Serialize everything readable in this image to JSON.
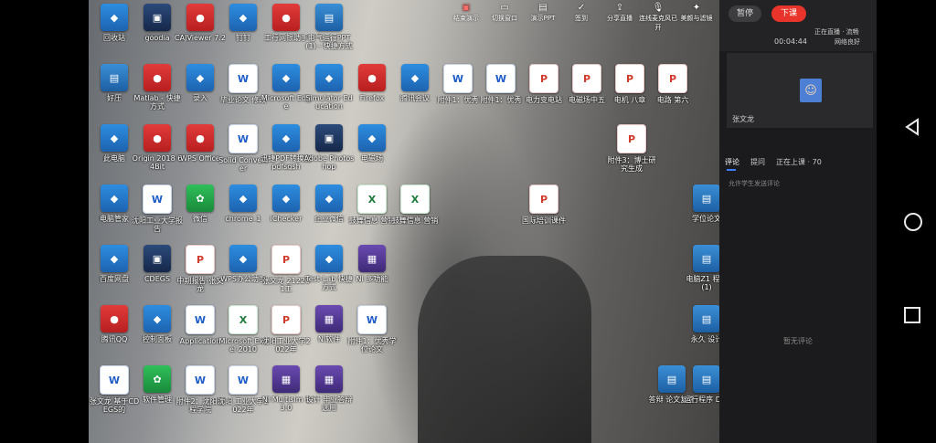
{
  "toolbar": {
    "items": [
      {
        "label": "结束演示",
        "icon": "screen-share-stop-icon",
        "color": "#ff6b6b"
      },
      {
        "label": "切换窗口",
        "icon": "window-switch-icon"
      },
      {
        "label": "演示PPT",
        "icon": "ppt-icon"
      },
      {
        "label": "签到",
        "icon": "check-in-icon"
      },
      {
        "label": "分享直播",
        "icon": "share-icon"
      },
      {
        "label": "连线麦克风已开",
        "icon": "mic-icon"
      },
      {
        "label": "美颜与滤镜",
        "icon": "beauty-icon"
      }
    ]
  },
  "desktop": {
    "rows": [
      [
        {
          "label": "回收站",
          "type": "app"
        },
        {
          "label": "goodia",
          "type": "dark"
        },
        {
          "label": "CAJViewer 7.2",
          "type": "red"
        },
        {
          "label": "钉钉",
          "type": "app"
        },
        {
          "label": "工行网银助手",
          "type": "red"
        },
        {
          "label": "电气运行PPT(1) - 快捷方式",
          "type": "rar"
        }
      ],
      [
        {
          "label": "好压",
          "type": "rar"
        },
        {
          "label": "Matlab - 快捷方式",
          "type": "red"
        },
        {
          "label": "录入",
          "type": "app"
        },
        {
          "label": "毕业论文 修改",
          "type": "doc"
        },
        {
          "label": "Microsoft Edge",
          "type": "app"
        },
        {
          "label": "Simulator Education",
          "type": "app"
        },
        {
          "label": "Firefox",
          "type": "red"
        },
        {
          "label": "腾讯会议",
          "type": "app"
        },
        {
          "label": "附件1：优秀",
          "type": "doc"
        },
        {
          "label": "附件1：优秀",
          "type": "doc"
        },
        {
          "label": "电力变电站",
          "type": "pdf"
        },
        {
          "label": "电磁场中五",
          "type": "pdf"
        },
        {
          "label": "电机 八章",
          "type": "pdf"
        },
        {
          "label": "电路 第六",
          "type": "pdf"
        }
      ],
      [
        {
          "label": "此电脑",
          "type": "app"
        },
        {
          "label": "Origin 2018 64Bit",
          "type": "red"
        },
        {
          "label": "WPS Office",
          "type": "red"
        },
        {
          "label": "Solid Converter",
          "type": "doc"
        },
        {
          "label": "迅捷PDF转换器pdfsgsh",
          "type": "app"
        },
        {
          "label": "Adobe Photoshop",
          "type": "dark"
        },
        {
          "label": "电磁场",
          "type": "app"
        },
        {
          "label": "附件3：博士研究生成",
          "type": "pdf"
        }
      ],
      [
        {
          "label": "电脑管家",
          "type": "app"
        },
        {
          "label": "沈阳工业大学报告",
          "type": "doc"
        },
        {
          "label": "微信",
          "type": "green"
        },
        {
          "label": "chrome_1",
          "type": "app"
        },
        {
          "label": "iChecker",
          "type": "app"
        },
        {
          "label": "企业微信",
          "type": "app"
        },
        {
          "label": "鼓舞信息 营销",
          "type": "xls"
        },
        {
          "label": "鼓舞信息 营销",
          "type": "xls"
        },
        {
          "label": "国际培训课件",
          "type": "pdf"
        },
        {
          "label": "学位论文",
          "type": "rar"
        }
      ],
      [
        {
          "label": "百度网盘",
          "type": "app"
        },
        {
          "label": "CDEGS",
          "type": "dark"
        },
        {
          "label": "中期报告-张文龙",
          "type": "pdf"
        },
        {
          "label": "WPS办公助手",
          "type": "app"
        },
        {
          "label": "张文龙 212201工",
          "type": "pdf"
        },
        {
          "label": "Test-Lab 快捷方式",
          "type": "app"
        },
        {
          "label": "NI 多功能",
          "type": "purple"
        },
        {
          "label": "电脑Z1 程序(1)",
          "type": "rar"
        }
      ],
      [
        {
          "label": "腾讯QQ",
          "type": "red"
        },
        {
          "label": "控制面板",
          "type": "app"
        },
        {
          "label": "Application",
          "type": "doc"
        },
        {
          "label": "Microsoft Excel 2010",
          "type": "xls"
        },
        {
          "label": "沈阳工业大学2022年",
          "type": "pdf"
        },
        {
          "label": "NI软件",
          "type": "purple"
        },
        {
          "label": "附件1：优秀学位论文",
          "type": "doc"
        },
        {
          "label": "永久 设计",
          "type": "rar"
        }
      ],
      [
        {
          "label": "张文龙 基于CDEGS的",
          "type": "doc"
        },
        {
          "label": "软件管理",
          "type": "green"
        },
        {
          "label": "附件2：沈阳工程学院",
          "type": "doc"
        },
        {
          "label": "沈阳 工业大学2022年",
          "type": "doc"
        },
        {
          "label": "NI Multisim 13.0",
          "type": "purple"
        },
        {
          "label": "设计 毕业答辩选用",
          "type": "purple"
        },
        {
          "label": "答辩 论文复查",
          "type": "rar"
        },
        {
          "label": "运行程序 DLL",
          "type": "rar"
        }
      ]
    ]
  },
  "side": {
    "pause_label": "暂停",
    "end_label": "下课",
    "live_status": "正在直播 · 流畅",
    "elapsed": "00:04:44",
    "network": "网络良好",
    "presenter_name": "张文龙",
    "tabs": [
      "评论",
      "提问",
      "正在上课 · 70"
    ],
    "permission_text": "允许学生发送评论",
    "empty_text": "暂无评论"
  },
  "colors": {
    "accent": "#3d7bff",
    "end_button": "#e8342a"
  }
}
